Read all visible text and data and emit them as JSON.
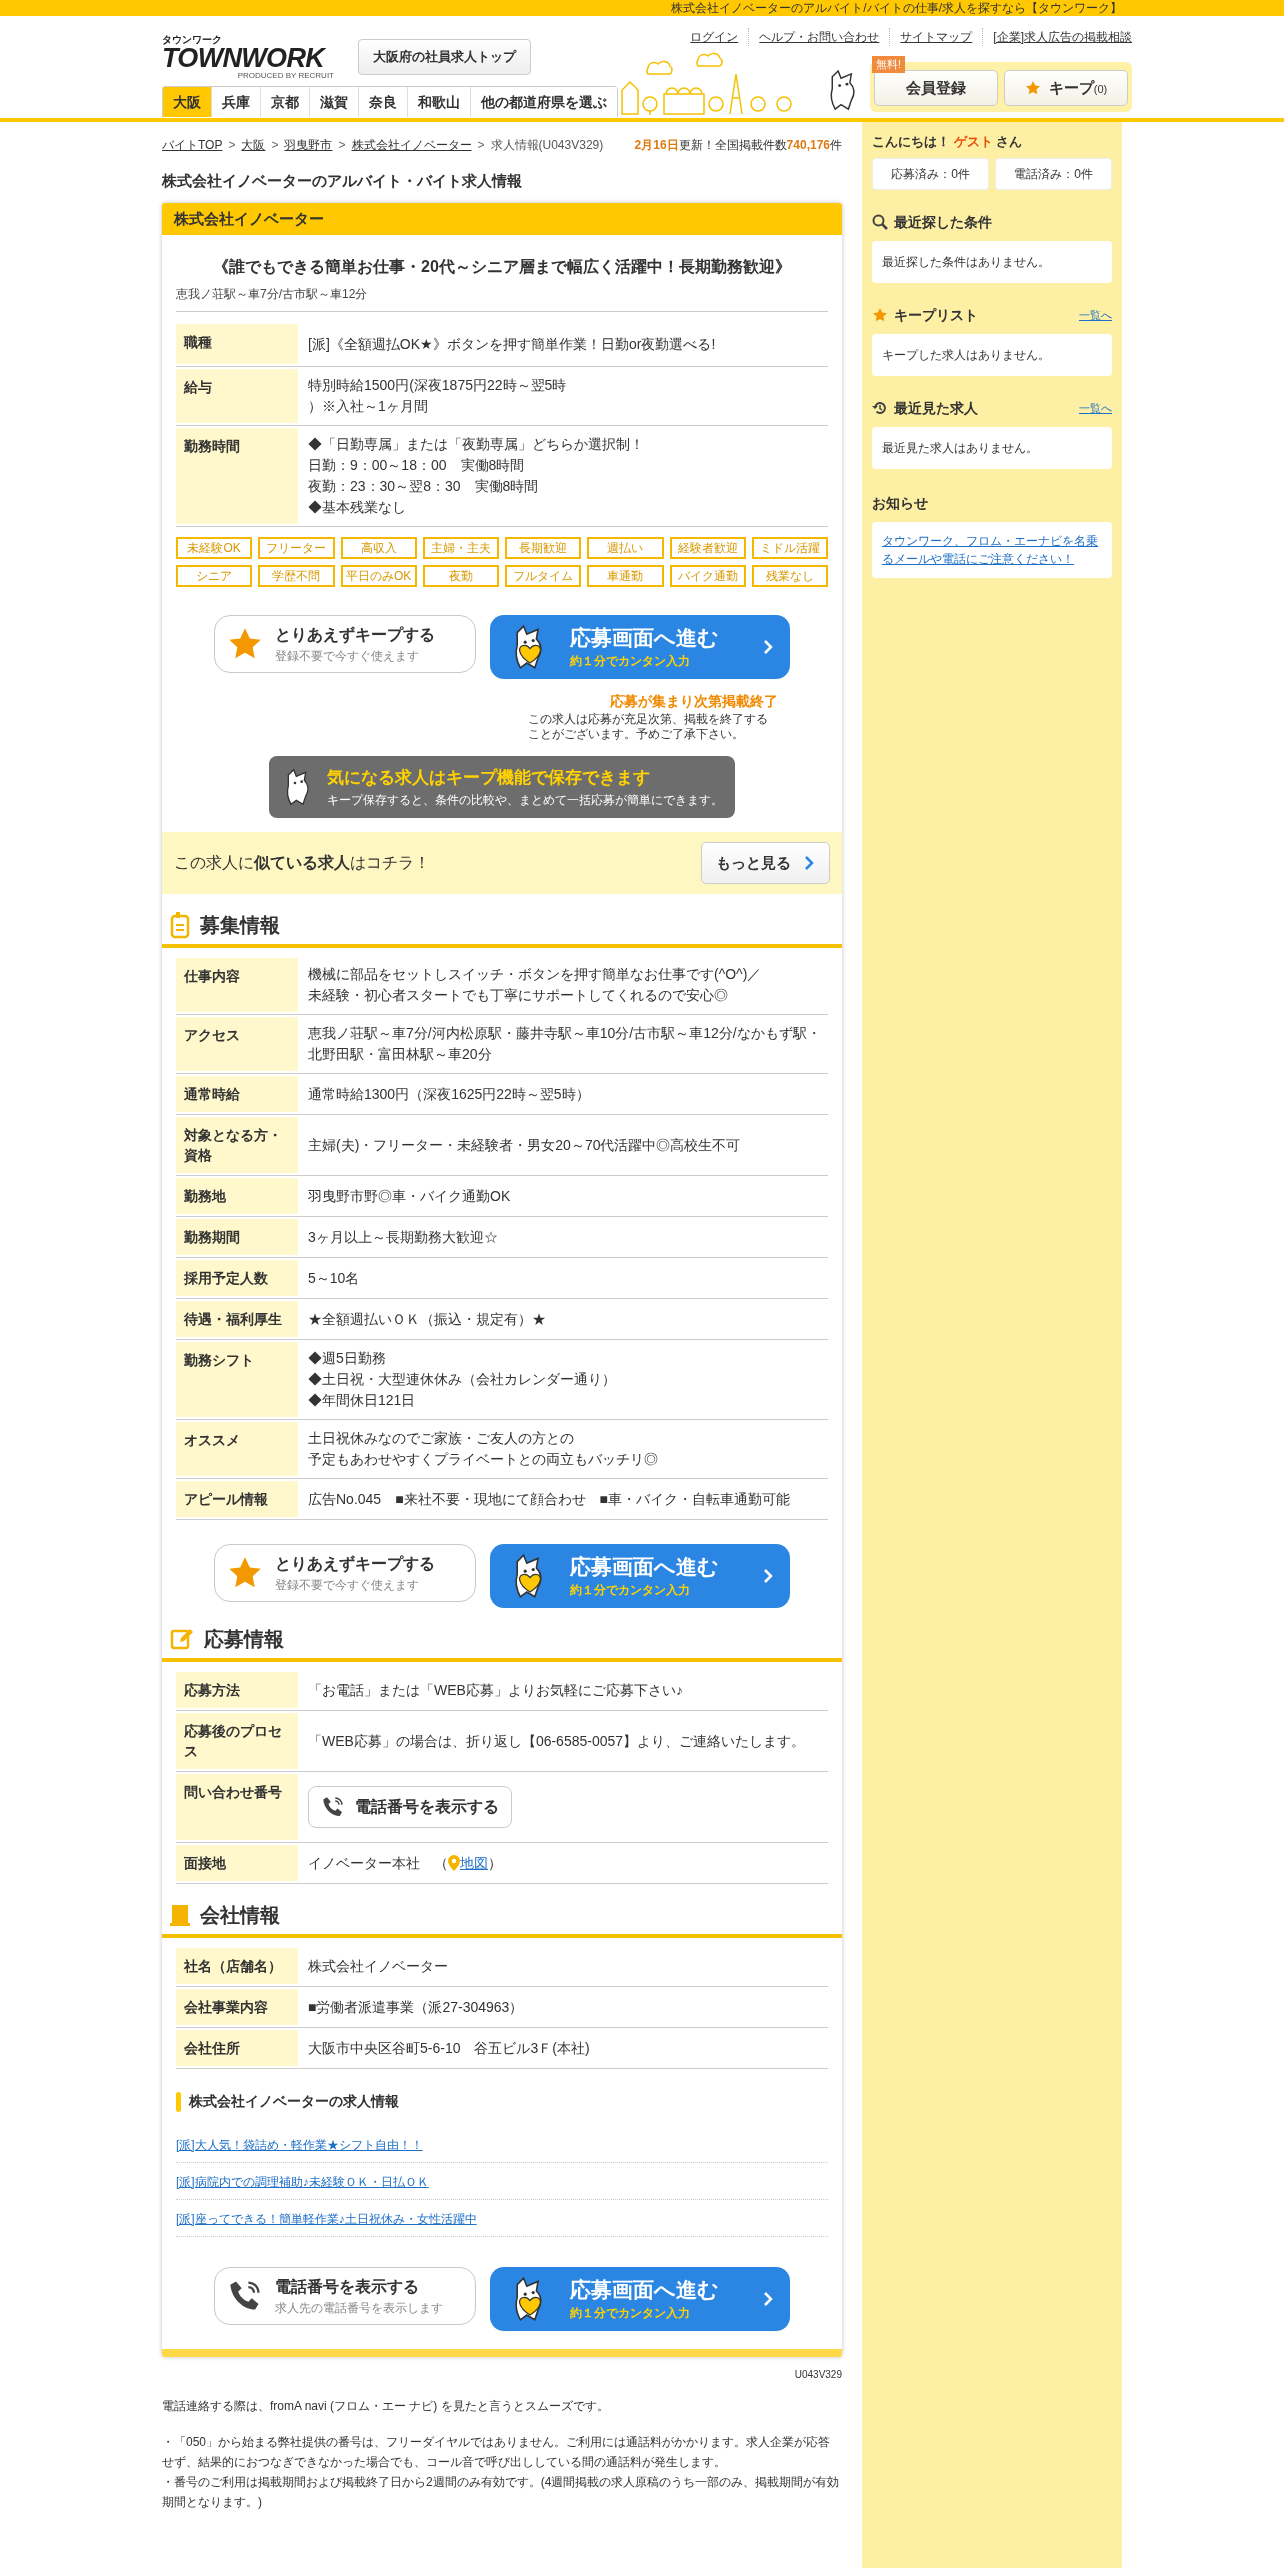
{
  "top_bar": {
    "text": "株式会社イノベーターのアルバイト/バイトの仕事/求人を探すなら【タウンワーク】"
  },
  "logo": {
    "kana": "タウンワーク",
    "wordmark": "TOWNWORK",
    "byline": "PRODUCED BY RECRUIT"
  },
  "top_button": "大阪府の社員求人トップ",
  "header_links": [
    "ログイン",
    "ヘルプ・お問い合わせ",
    "サイトマップ",
    "[企業]求人広告の掲載相談"
  ],
  "region_tabs": [
    {
      "label": "大阪",
      "selected": true
    },
    {
      "label": "兵庫",
      "selected": false
    },
    {
      "label": "京都",
      "selected": false
    },
    {
      "label": "滋賀",
      "selected": false
    },
    {
      "label": "奈良",
      "selected": false
    },
    {
      "label": "和歌山",
      "selected": false
    },
    {
      "label": "他の都道府県を選ぶ",
      "selected": false
    }
  ],
  "member_button": {
    "label": "会員登録",
    "badge": "無料!"
  },
  "keep_button": {
    "label": "キープ",
    "count": "(0)"
  },
  "breadcrumb": [
    {
      "label": "バイトTOP",
      "link": true
    },
    {
      "separator": ">",
      "label": "大阪",
      "link": true
    },
    {
      "separator": ">",
      "label": "羽曳野市",
      "link": true
    },
    {
      "separator": ">",
      "label": "株式会社イノベーター",
      "link": true
    },
    {
      "separator": ">",
      "label": "求人情報(U043V329)",
      "link": false
    }
  ],
  "update": {
    "date": "2月16日",
    "middle": "更新！全国掲載件数",
    "count": "740,176",
    "unit": "件"
  },
  "page_title": "株式会社イノベーターのアルバイト・バイト求人情報",
  "card": {
    "company": "株式会社イノベーター",
    "catch": "《誰でもできる簡単お仕事・20代～シニア層まで幅広く活躍中！長期勤務歓迎》",
    "stations": "恵我ノ荘駅～車7分/古市駅～車12分",
    "summary": [
      {
        "label": "職種",
        "lines": [
          "[派]《全額週払OK★》ボタンを押す簡単作業！日勤or夜勤選べる!"
        ]
      },
      {
        "label": "給与",
        "lines": [
          "特別時給1500円(深夜1875円22時～翌5時",
          "）※入社～1ヶ月間"
        ]
      },
      {
        "label": "勤務時間",
        "lines": [
          "◆「日勤専属」または「夜勤専属」どちらか選択制！",
          "日勤：9：00～18：00　実働8時間",
          "夜勤：23：30～翌8：30　実働8時間",
          "◆基本残業なし"
        ]
      }
    ],
    "tags": [
      "未経験OK",
      "フリーター",
      "高収入",
      "主婦・主夫",
      "長期歓迎",
      "週払い",
      "経験者歓迎",
      "ミドル活躍",
      "シニア",
      "学歴不問",
      "平日のみOK",
      "夜勤",
      "フルタイム",
      "車通勤",
      "バイク通勤",
      "残業なし"
    ],
    "keep_action": {
      "title": "とりあえずキープする",
      "sub": "登録不要で今すぐ使えます"
    },
    "apply_action": {
      "title": "応募画面へ進む",
      "sub": "約１分でカンタン入力"
    },
    "notice": {
      "title": "応募が集まり次第掲載終了",
      "text": "この求人は応募が充足次第、掲載を終了することがございます。予めご了承下さい。"
    },
    "keep_banner": {
      "title": "気になる求人はキープ機能で保存できます",
      "text": "キープ保存すると、条件の比較や、まとめて一括応募が簡単にできます。"
    }
  },
  "similar": {
    "text": "この求人に**似ている求人**はコチラ！",
    "button": "もっと見る"
  },
  "recruitment": {
    "title": "募集情報",
    "rows": [
      {
        "label": "仕事内容",
        "lines": [
          "機械に部品をセットしスイッチ・ボタンを押す簡単なお仕事です(^O^)／",
          "未経験・初心者スタートでも丁寧にサポートしてくれるので安心◎"
        ]
      },
      {
        "label": "アクセス",
        "lines": [
          "恵我ノ荘駅～車7分/河内松原駅・藤井寺駅～車10分/古市駅～車12分/なかもず駅・",
          "北野田駅・富田林駅～車20分"
        ]
      },
      {
        "label": "通常時給",
        "lines": [
          "通常時給1300円（深夜1625円22時～翌5時）"
        ]
      },
      {
        "label": "対象となる方・資格",
        "lines": [
          "主婦(夫)・フリーター・未経験者・男女20～70代活躍中◎高校生不可"
        ]
      },
      {
        "label": "勤務地",
        "lines": [
          "羽曳野市野◎車・バイク通勤OK"
        ]
      },
      {
        "label": "勤務期間",
        "lines": [
          "3ヶ月以上～長期勤務大歓迎☆"
        ]
      },
      {
        "label": "採用予定人数",
        "lines": [
          "5～10名"
        ]
      },
      {
        "label": "待遇・福利厚生",
        "lines": [
          "★全額週払いＯＫ（振込・規定有）★"
        ]
      },
      {
        "label": "勤務シフト",
        "lines": [
          "◆週5日勤務",
          "◆土日祝・大型連休休み（会社カレンダー通り）",
          "◆年間休日121日"
        ]
      },
      {
        "label": "オススメ",
        "lines": [
          "土日祝休みなのでご家族・ご友人の方との",
          "予定もあわせやすくプライベートとの両立もバッチリ◎"
        ]
      },
      {
        "label": "アピール情報",
        "lines": [
          "広告No.045　■来社不要・現地にて顔合わせ　■車・バイク・自転車通勤可能"
        ]
      }
    ],
    "keep_action": {
      "title": "とりあえずキープする",
      "sub": "登録不要で今すぐ使えます"
    },
    "apply_action": {
      "title": "応募画面へ進む",
      "sub": "約１分でカンタン入力"
    }
  },
  "application": {
    "title": "応募情報",
    "rows": [
      {
        "kind": "text",
        "label": "応募方法",
        "value": "「お電話」または「WEB応募」よりお気軽にご応募下さい♪"
      },
      {
        "kind": "text",
        "label": "応募後のプロセス",
        "value": "「WEB応募」の場合は、折り返し【06-6585-0057】より、ご連絡いたします。"
      },
      {
        "kind": "phone",
        "label": "問い合わせ番号",
        "value": "電話番号を表示する"
      },
      {
        "kind": "place",
        "label": "面接地",
        "value": "イノベーター本社　（",
        "link": "地図",
        "after": "）"
      }
    ]
  },
  "company": {
    "title": "会社情報",
    "rows": [
      {
        "label": "社名（店舗名）",
        "lines": [
          "株式会社イノベーター"
        ]
      },
      {
        "label": "会社事業内容",
        "lines": [
          "■労働者派遣事業（派27-304963）"
        ]
      },
      {
        "label": "会社住所",
        "lines": [
          "大阪市中央区谷町5-6-10　谷五ビル3Ｆ(本社)"
        ]
      }
    ],
    "jobs_heading": "株式会社イノベーターの求人情報",
    "jobs": [
      "[派]大人気！袋詰め・軽作業★シフト自由！！",
      "[派]病院内での調理補助♪未経験ＯＫ・日払ＯＫ",
      "[派]座ってできる！簡単軽作業♪土日祝休み・女性活躍中"
    ],
    "phone_action": {
      "title": "電話番号を表示する",
      "sub": "求人先の電話番号を表示します"
    },
    "apply_action": {
      "title": "応募画面へ進む",
      "sub": "約１分でカンタン入力"
    }
  },
  "page_code": "U043V329",
  "notes": [
    "電話連絡する際は、fromA navi (フロム・エー ナビ) を見たと言うとスムーズです。",
    "・「050」から始まる弊社提供の番号は、フリーダイヤルではありません。ご利用には通話料がかかります。求人企業が応答せず、結果的におつなぎできなかった場合でも、コール音で呼び出ししている間の通話料が発生します。",
    "・番号のご利用は掲載期間および掲載終了日から2週間のみ有効です。(4週間掲載の求人原稿のうち一部のみ、掲載期間が有効期間となります。)"
  ],
  "sidebar": {
    "greeting": {
      "prefix": "こんにちは！",
      "name": "ゲスト",
      "suffix": "さん"
    },
    "counters": [
      "応募済み：0件",
      "電話済み：0件"
    ],
    "panels": [
      {
        "kind": "search",
        "title": "最近探した条件",
        "message": "最近探した条件はありません。"
      },
      {
        "kind": "star",
        "title": "キープリスト",
        "link": "一覧へ",
        "message": "キープした求人はありません。"
      },
      {
        "kind": "history",
        "title": "最近見た求人",
        "link": "一覧へ",
        "message": "最近見た求人はありません。"
      }
    ],
    "news": {
      "title": "お知らせ",
      "link": "タウンワーク、フロム・エーナビを名乗るメールや電話にご注意ください！"
    }
  }
}
